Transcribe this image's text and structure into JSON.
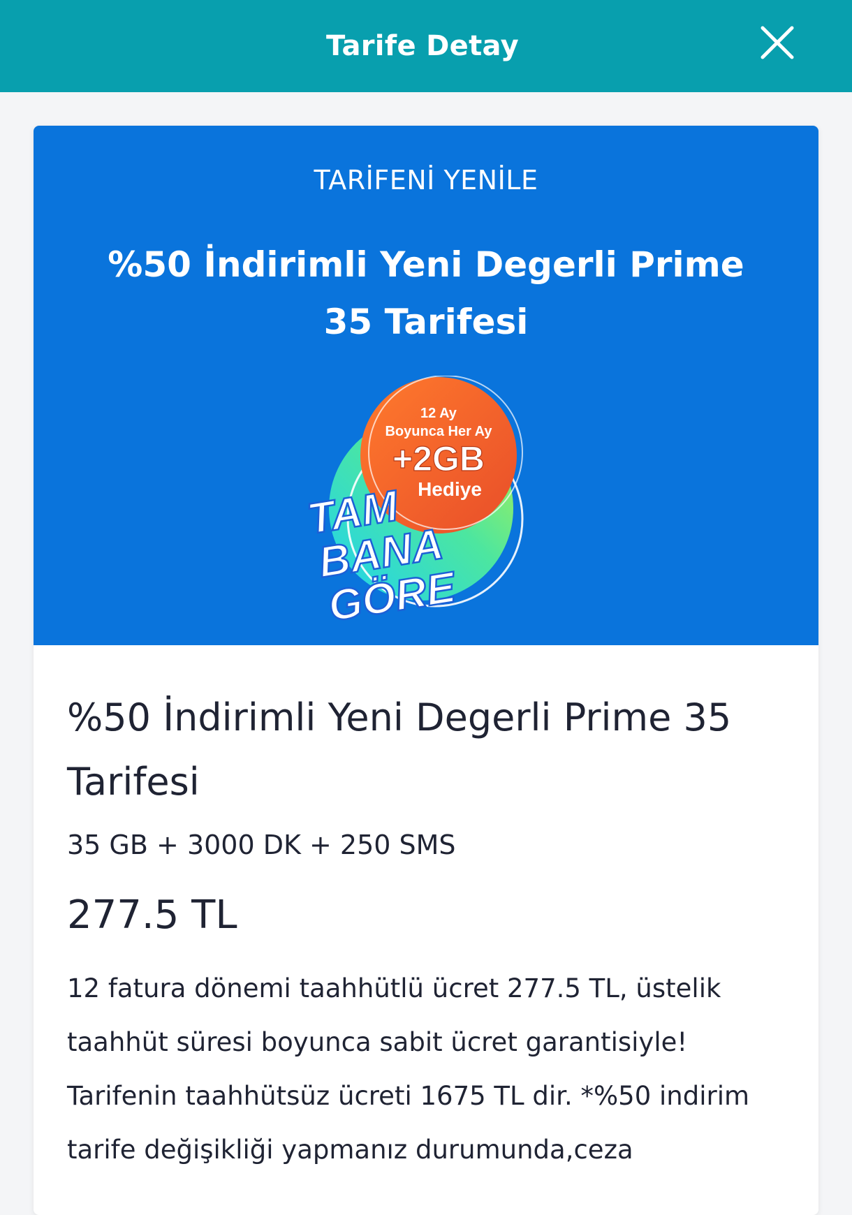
{
  "header": {
    "title": "Tarife Detay",
    "close_icon": "close-icon"
  },
  "hero": {
    "kicker": "TARİFENİ YENİLE",
    "headline": "%50 İndirimli Yeni Degerli Prime 35 Tarifesi",
    "badge": {
      "line1": "12 Ay",
      "line2": "Boyunca Her Ay",
      "amount": "+2GB",
      "gift": "Hediye",
      "slogan1": "TAM",
      "slogan2": "BANA",
      "slogan3": "GÖRE"
    },
    "color": "#0a74dc"
  },
  "tariff": {
    "name": "%50 İndirimli Yeni Degerli Prime 35 Tarifesi",
    "package": "35 GB + 3000 DK + 250 SMS",
    "price": "277.5 TL",
    "description": "12 fatura dönemi taahhütlü ücret 277.5 TL, üstelik taahhüt süresi boyunca sabit ücret garantisiyle! Tarifenin taahhütsüz ücreti 1675 TL dir. *%50 indirim tarife değişikliği yapmanız durumunda,ceza"
  },
  "colors": {
    "topbar": "#089fae",
    "text": "#1f2333",
    "badge_orange": "#f0602a"
  }
}
